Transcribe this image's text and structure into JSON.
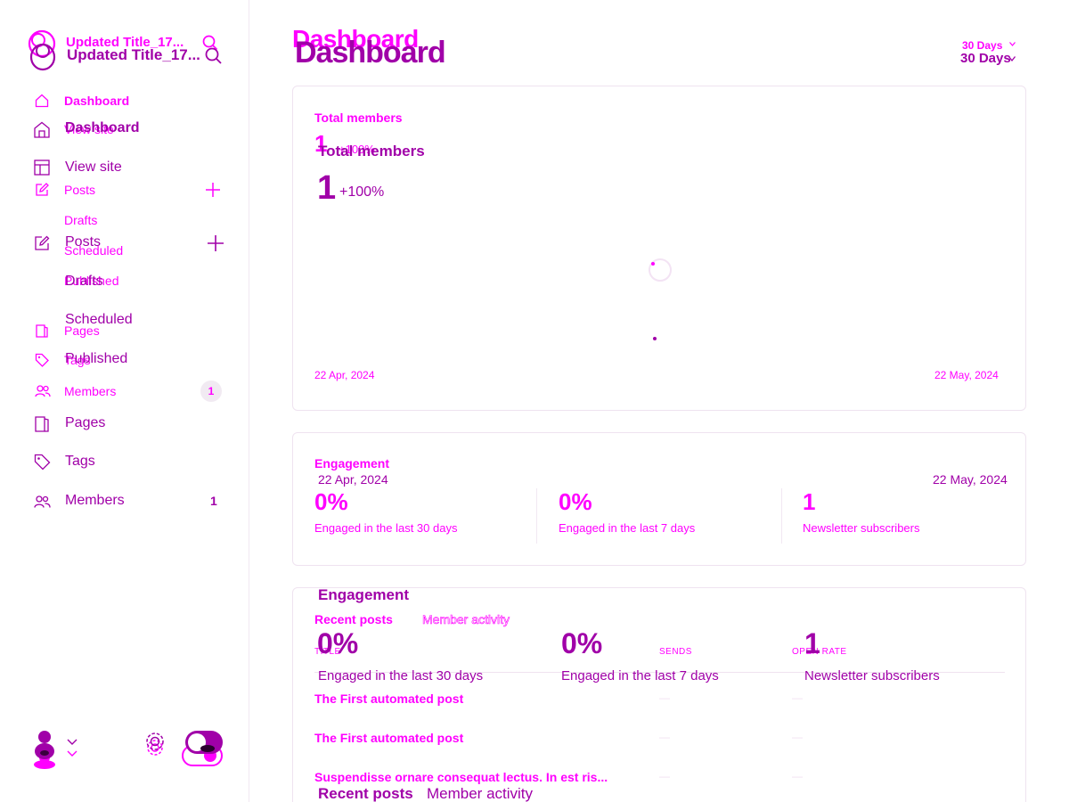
{
  "site": {
    "title": "Updated Title_17..."
  },
  "nav": {
    "dashboard": "Dashboard",
    "view_site": "View site",
    "posts": "Posts",
    "drafts": "Drafts",
    "scheduled": "Scheduled",
    "published": "Published",
    "pages": "Pages",
    "tags": "Tags",
    "members": "Members",
    "members_count": "1"
  },
  "header": {
    "title": "Dashboard",
    "range": "30 Days"
  },
  "members_card": {
    "label": "Total members",
    "value": "1",
    "change": "+100%",
    "date_start": "22 Apr, 2024",
    "date_end": "22 May, 2024"
  },
  "engagement": {
    "label": "Engagement",
    "stats": [
      {
        "value": "0%",
        "label": "Engaged in the last 30 days"
      },
      {
        "value": "0%",
        "label": "Engaged in the last 7 days"
      },
      {
        "value": "1",
        "label": "Newsletter subscribers"
      }
    ]
  },
  "recent": {
    "tab_posts": "Recent posts",
    "tab_activity": "Member activity",
    "columns": [
      "TITLE",
      "SENDS",
      "OPEN RATE"
    ],
    "rows": [
      {
        "title": "The First automated post",
        "sends": "—",
        "open": "—"
      },
      {
        "title": "The First automated post",
        "sends": "—",
        "open": "—"
      },
      {
        "title": "Suspendisse ornare consequat lectus. In est ris...",
        "sends": "—",
        "open": "—"
      }
    ]
  },
  "colors": {
    "primary": "#ff00ff",
    "ghost": "#a000a8",
    "background": "#ffffff"
  },
  "icons": [
    "logo-icon",
    "search-icon",
    "home-icon",
    "view-site-icon",
    "edit-icon",
    "plus-icon",
    "page-icon",
    "tag-icon",
    "members-icon",
    "avatar",
    "chevron-down-icon",
    "gear-icon",
    "toggle-icon"
  ]
}
